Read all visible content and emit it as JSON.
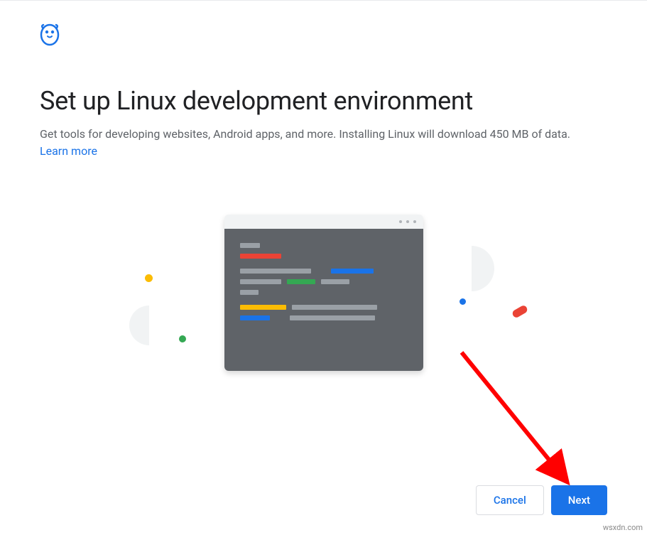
{
  "header": {
    "title": "Set up Linux development environment",
    "subtitle": "Get tools for developing websites, Android apps, and more. Installing Linux will download 450 MB of data.",
    "learn_more": "Learn more"
  },
  "footer": {
    "cancel_label": "Cancel",
    "next_label": "Next"
  },
  "watermark": "wsxdn.com",
  "colors": {
    "primary": "#1a73e8",
    "red": "#ea4335",
    "yellow": "#fbbc04",
    "green": "#34a853",
    "grey": "#5f6368"
  }
}
